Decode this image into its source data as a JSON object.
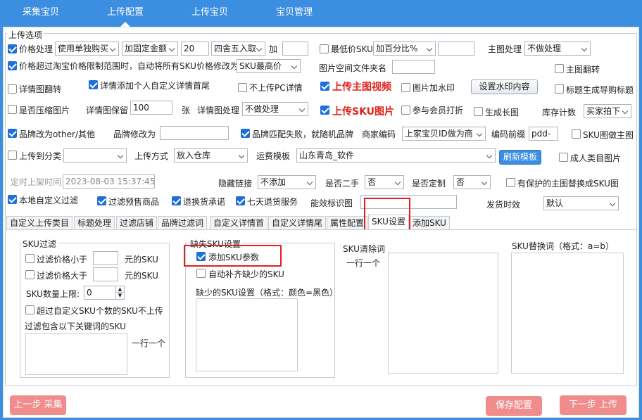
{
  "top_tabs": [
    "采集宝贝",
    "上传配置",
    "上传宝贝",
    "宝贝管理"
  ],
  "group_title": "上传选项",
  "r1": {
    "price": "价格处理",
    "price_mode": "使用单独购买",
    "fix": "加固定金额",
    "fix_val": "20",
    "round": "四舍五入取",
    "add": "加",
    "lowest": "最低价SKU",
    "percent": "加百分比%",
    "main_img": "主图处理",
    "main_img_val": "不做处理"
  },
  "r2": {
    "over": "价格超过淘宝价格限制范围时，自动将所有SKU价格修改为",
    "sku_max": "SKU最高价",
    "folder": "图片空间文件夹名",
    "flip_main": "主图翻转"
  },
  "r3": {
    "flip_detail": "详情图翻转",
    "custom_tail": "详情添加个人自定义详情首尾",
    "no_pc": "不上传PC详情",
    "video": "上传主图视频",
    "watermark": "图片加水印",
    "set_wm": "设置水印内容",
    "nav_title": "标题生成导购标题"
  },
  "r4": {
    "compress": "是否压缩图片",
    "keep": "详情图保留",
    "keep_val": "100",
    "unit": "张",
    "detail_proc": "详情图处理",
    "detail_proc_val": "不做处理",
    "sku_img": "上传SKU图片",
    "member": "参与会员打折",
    "long": "生成长图",
    "stock": "库存计数",
    "stock_val": "买家拍下"
  },
  "r5": {
    "brand_other": "品牌改为other/其他",
    "brand_change": "品牌修改为",
    "brand_fail": "品牌匹配失败，就随机品牌",
    "code": "商家编码",
    "code_val": "上家宝贝ID做为商",
    "prefix": "编码前缀",
    "prefix_val": "pdd-",
    "sku_main": "SKU图做主图"
  },
  "r6": {
    "cat": "上传到分类",
    "method": "上传方式",
    "method_val": "放入仓库",
    "ship": "运费模板",
    "ship_val": "山东青岛_软件",
    "refresh": "刷新模板",
    "adult": "成人类目图片"
  },
  "r7": {
    "timer": "定时上架时间",
    "timer_val": "2023-08-03 15:37:45",
    "hidden": "隐藏链接",
    "hidden_val": "不添加",
    "second": "是否二手",
    "second_val": "否",
    "custom": "是否定制",
    "custom_val": "否",
    "protect": "有保护的主图替换成SKU图"
  },
  "r8": {
    "local": "本地自定义过滤",
    "presale": "过滤预售商品",
    "return": "退换货承诺",
    "seven": "七天退货服务",
    "energy": "能效标识图",
    "delivery": "发货时效",
    "delivery_val": "默认"
  },
  "subtabs": [
    "自定义上传类目",
    "标题处理",
    "过滤店铺",
    "品牌过滤词",
    "自定义详情首",
    "自定义详情尾",
    "属性配置",
    "SKU设置",
    "添加SKU"
  ],
  "sku_filter": {
    "title": "SKU过滤",
    "lt": "过滤价格小于",
    "gt": "过滤价格大于",
    "unit": "元的SKU",
    "limit": "SKU数量上限:",
    "limit_val": "0",
    "over_custom": "超过自定义SKU个数的SKU不上传",
    "kw": "过滤包含以下关键词的SKU",
    "per_line": "一行一个"
  },
  "missing": {
    "title": "缺失SKU设置",
    "add": "添加SKU参数",
    "auto": "自动补齐缺少的SKU",
    "setting": "缺少的SKU设置（格式：颜色=黑色）"
  },
  "clear": {
    "title": "SKU清除词",
    "per_line": "一行一个"
  },
  "replace": {
    "title": "SKU替换词（格式：a=b）"
  },
  "bottom": {
    "prev": "上一步 采集",
    "save": "保存配置",
    "next": "下一步 上传"
  }
}
